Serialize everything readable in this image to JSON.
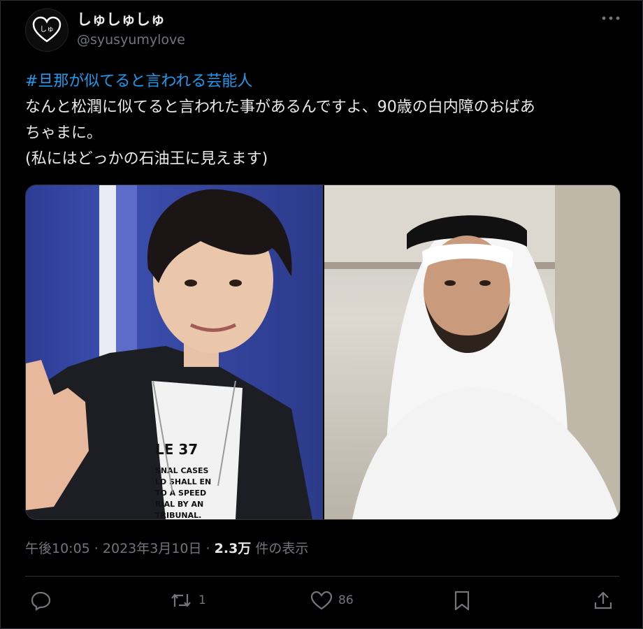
{
  "author": {
    "display_name": "しゅしゅしゅ",
    "handle": "@syusyumylove",
    "avatar_text": "しゅ"
  },
  "tweet": {
    "hashtag": "#旦那が似てると言われる芸能人",
    "lines": [
      "なんと松潤に似てると言われた事があるんですよ、90歳の白内障のおばあ",
      "ちゃまに。",
      "(私にはどっかの石油王に見えます)"
    ]
  },
  "media": {
    "left_shirt_text": [
      "LE 37",
      "SNAL  CASES",
      "LD SHALL EN",
      "TO A  SPEED",
      "RIAL BY AN",
      "TRIBUNAL."
    ]
  },
  "meta": {
    "time": "午後10:05",
    "sep1": " · ",
    "date": "2023年3月10日",
    "sep2": " · ",
    "views_count": "2.3万",
    "views_label": " 件の表示"
  },
  "actions": {
    "retweet_count": "1",
    "like_count": "86"
  },
  "colors": {
    "accent": "#1d9bf0",
    "secondary_text": "#71767b",
    "background": "#000000"
  }
}
